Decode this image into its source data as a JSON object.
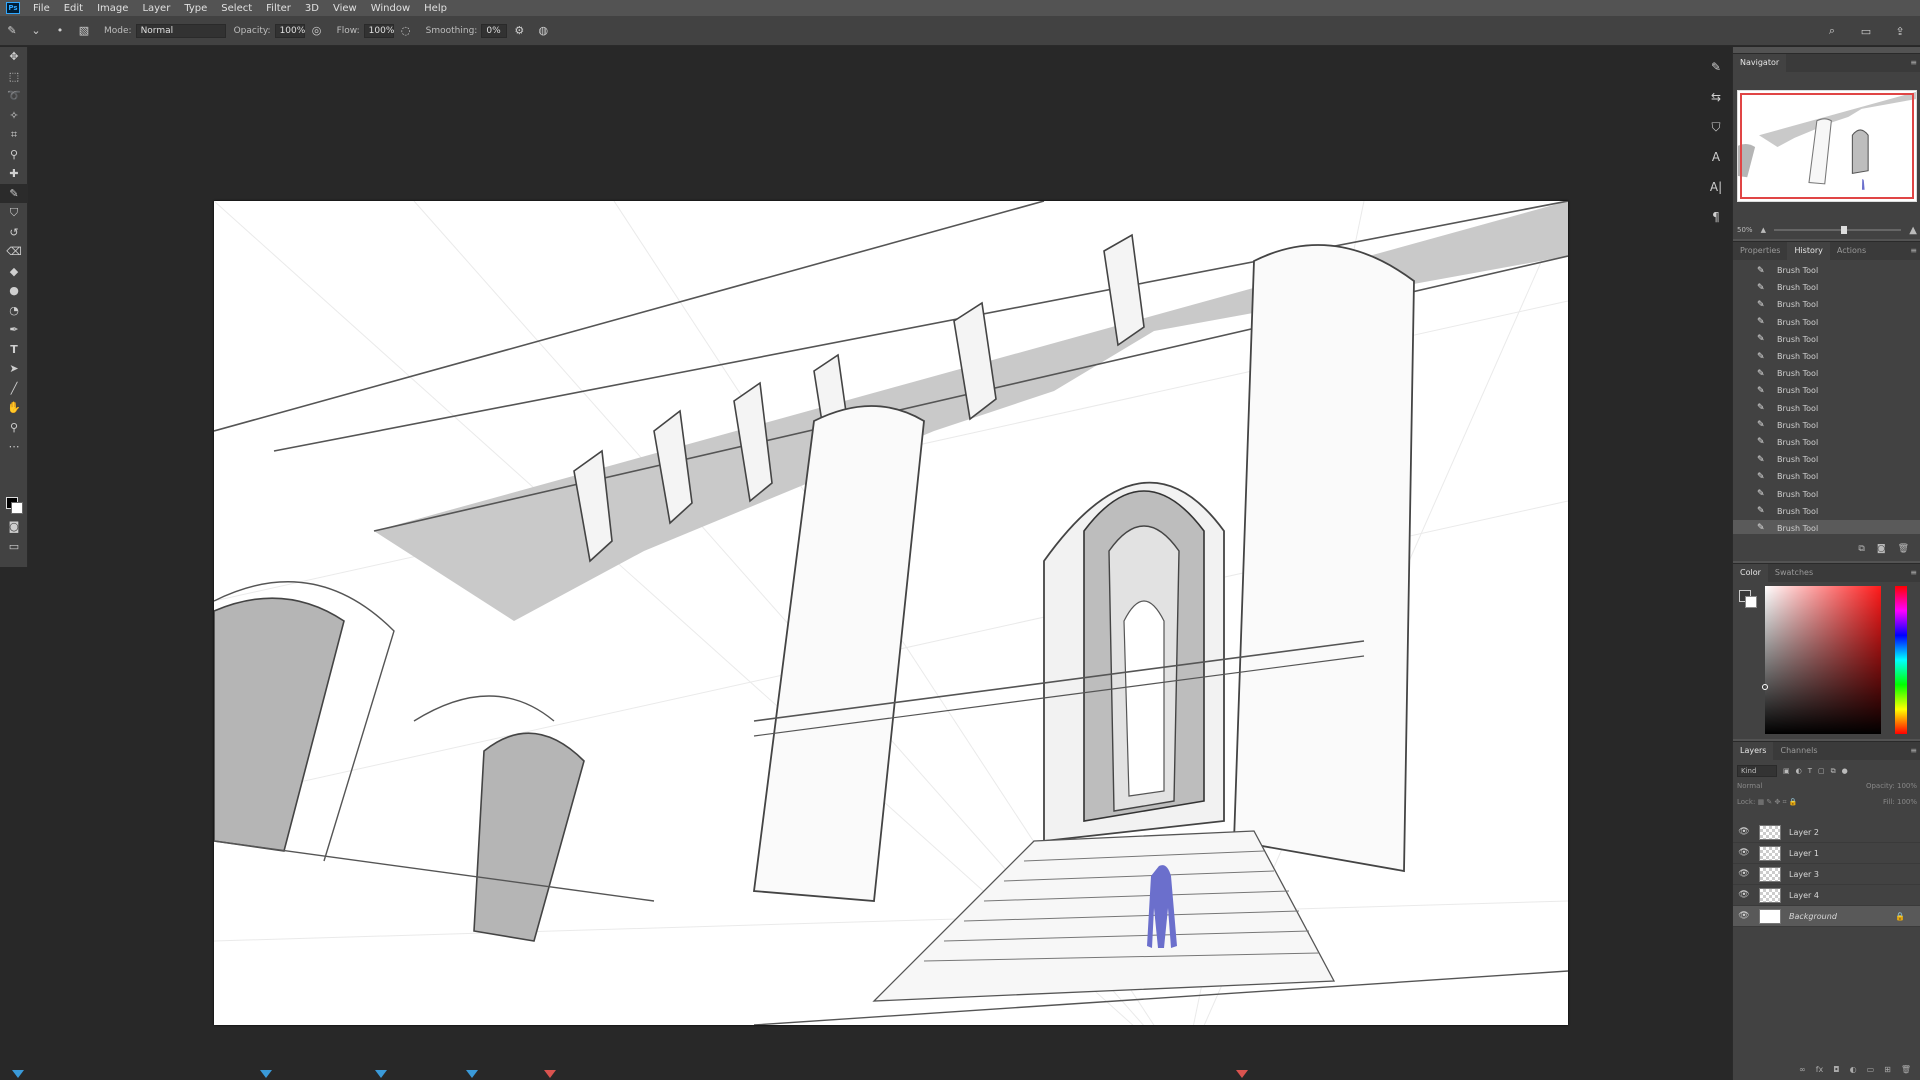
{
  "app": {
    "logo": "Ps"
  },
  "menu": [
    "File",
    "Edit",
    "Image",
    "Layer",
    "Type",
    "Select",
    "Filter",
    "3D",
    "View",
    "Window",
    "Help"
  ],
  "options": {
    "mode_label": "Mode:",
    "mode_value": "Normal",
    "opacity_label": "Opacity:",
    "opacity_value": "100%",
    "flow_label": "Flow:",
    "flow_value": "100%",
    "smoothing_label": "Smoothing:",
    "smoothing_value": "0%"
  },
  "tools": [
    "move-tool",
    "marquee-tool",
    "lasso-tool",
    "magic-wand-tool",
    "crop-tool",
    "eyedropper-tool",
    "healing-brush-tool",
    "brush-tool",
    "clone-stamp-tool",
    "history-brush-tool",
    "eraser-tool",
    "paint-bucket-tool",
    "blur-tool",
    "dodge-tool",
    "pen-tool",
    "type-tool",
    "path-selection-tool",
    "line-tool",
    "hand-tool",
    "zoom-tool",
    "more-tools"
  ],
  "navigator": {
    "tab": "Navigator",
    "zoom": "50%",
    "zoom_fraction": 0.55
  },
  "history": {
    "tabs": [
      "Properties",
      "History",
      "Actions"
    ],
    "active_tab": "History",
    "items": [
      "Brush Tool",
      "Brush Tool",
      "Brush Tool",
      "Brush Tool",
      "Brush Tool",
      "Brush Tool",
      "Brush Tool",
      "Brush Tool",
      "Brush Tool",
      "Brush Tool",
      "Brush Tool",
      "Brush Tool",
      "Brush Tool",
      "Brush Tool",
      "Brush Tool",
      "Brush Tool"
    ]
  },
  "color": {
    "tabs": [
      "Color",
      "Swatches"
    ],
    "active_tab": "Color",
    "hue": "#ff1a1a"
  },
  "layers": {
    "tabs": [
      "Layers",
      "Channels"
    ],
    "active_tab": "Layers",
    "kind": "Kind",
    "blend": "Normal",
    "opacity_label": "Opacity:",
    "opacity_value": "100%",
    "lock_label": "Lock:",
    "fill_label": "Fill:",
    "fill_value": "100%",
    "items": [
      {
        "name": "Layer 2"
      },
      {
        "name": "Layer 1"
      },
      {
        "name": "Layer 3"
      },
      {
        "name": "Layer 4"
      },
      {
        "name": "Background"
      }
    ]
  }
}
